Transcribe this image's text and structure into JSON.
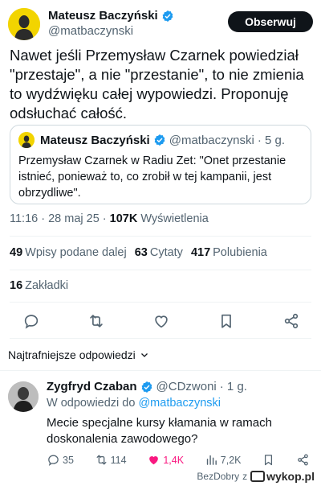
{
  "tweet": {
    "author_name": "Mateusz Baczyński",
    "author_handle": "@matbaczynski",
    "follow_label": "Obserwuj",
    "text": "Nawet jeśli Przemysław Czarnek powiedział \"przestaje\", a nie \"przestanie\", to nie zmienia to wydźwięku całej wypowiedzi. Proponuję odsłuchać całość.",
    "quote": {
      "author_name": "Mateusz Baczyński",
      "author_handle": "@matbaczynski",
      "time": "· 5 g.",
      "text": "Przemysław Czarnek w Radiu Zet: \"Onet przestanie istnieć, ponieważ to, co zrobił w tej kampanii, jest obrzydliwe\"."
    },
    "timestamp": "11:16 · 28 maj 25 ·",
    "views_count": "107K",
    "views_label": "Wyświetlenia",
    "stats": {
      "reposts_count": "49",
      "reposts_label": "Wpisy podane dalej",
      "quotes_count": "63",
      "quotes_label": "Cytaty",
      "likes_count": "417",
      "likes_label": "Polubienia",
      "bookmarks_count": "16",
      "bookmarks_label": "Zakładki"
    },
    "icons": [
      "reply-icon",
      "retweet-icon",
      "like-icon",
      "bookmark-icon",
      "share-icon"
    ]
  },
  "replies_header": {
    "label": "Najtrafniejsze odpowiedzi"
  },
  "reply": {
    "author_name": "Zygfryd Czaban",
    "author_handle": "@CDzwoni",
    "time": "· 1 g.",
    "reply_to_prefix": "W odpowiedzi do",
    "reply_to_handle": "@matbaczynski",
    "text": "Mecie specjalne kursy kłamania w ramach doskonalenia zawodowego?",
    "replies": "35",
    "retweets": "114",
    "likes": "1,4K",
    "views": "7,2K"
  },
  "watermark": {
    "user": "BezDobry",
    "prefix": "z",
    "site": "wykop.pl"
  },
  "colors": {
    "accent": "#1d9bf0",
    "like": "#f91880",
    "muted": "#536471",
    "avatar_bg": "#f2d400"
  }
}
